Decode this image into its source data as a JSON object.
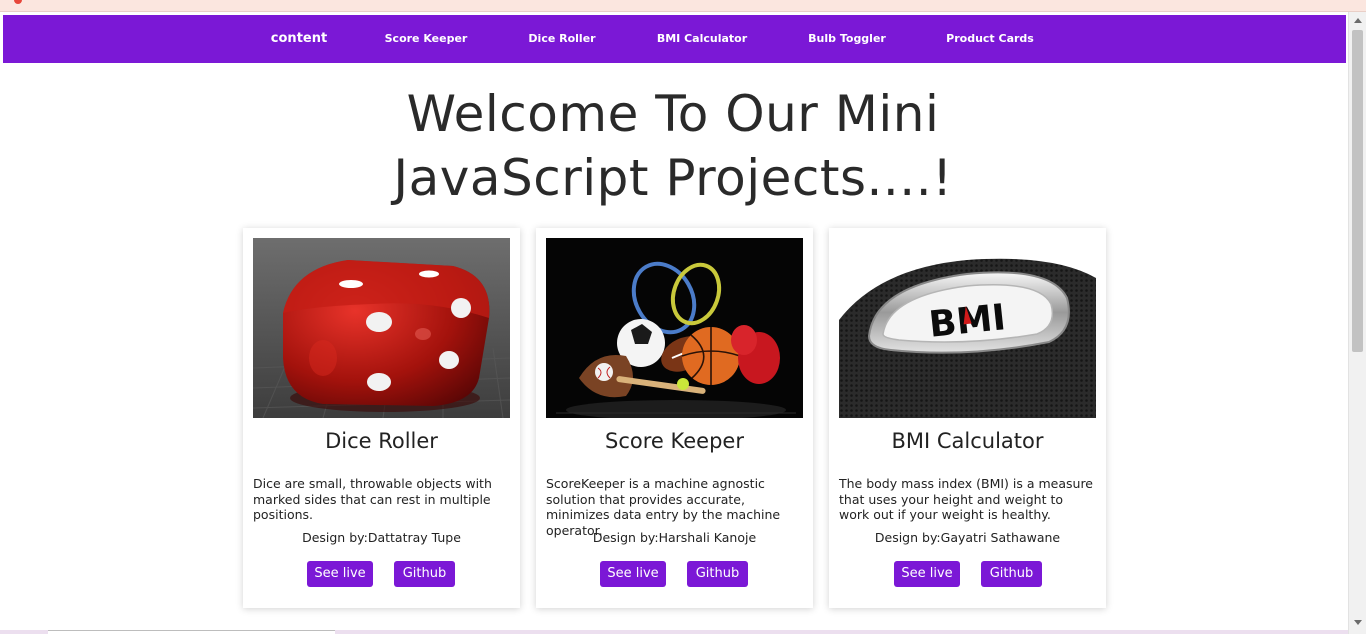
{
  "nav": {
    "brand": "content",
    "items": [
      {
        "label": "Score Keeper"
      },
      {
        "label": "Dice Roller"
      },
      {
        "label": "BMI Calculator"
      },
      {
        "label": "Bulb Toggler"
      },
      {
        "label": "Product Cards"
      }
    ]
  },
  "hero": {
    "line1": "Welcome To Our Mini",
    "line2": "JavaScript Projects....!"
  },
  "cards": [
    {
      "title": "Dice Roller",
      "description": "Dice are small, throwable objects with marked sides that can rest in multiple positions.",
      "designer": "Design by:Dattatray Tupe",
      "live_label": "See live",
      "github_label": "Github",
      "image": "red-dice-image"
    },
    {
      "title": "Score Keeper",
      "description": "ScoreKeeper is a machine agnostic solution that provides accurate, minimizes data entry by the machine operator.",
      "designer": "Design by:Harshali Kanoje",
      "live_label": "See live",
      "github_label": "Github",
      "image": "sports-equipment-image"
    },
    {
      "title": "BMI Calculator",
      "description": "The body mass index (BMI) is a measure that uses your height and weight to work out if your weight is healthy.",
      "designer": "Design by:Gayatri Sathawane",
      "live_label": "See live",
      "github_label": "Github",
      "image": "bmi-scale-image",
      "image_text": "BMI"
    }
  ],
  "colors": {
    "accent": "#7b18d6",
    "nav_text": "#ffffff",
    "heading": "#2a2a2a"
  }
}
